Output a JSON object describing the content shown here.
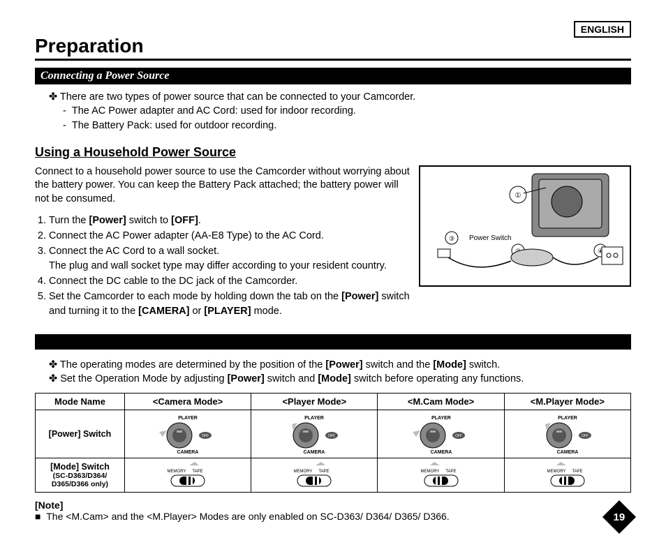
{
  "lang": "ENGLISH",
  "title": "Preparation",
  "section1": "Connecting a Power Source",
  "intro": "There are two types of power source that can be connected to your Camcorder.",
  "intro_sub1": "The AC Power adapter and AC Cord: used for indoor recording.",
  "intro_sub2": "The Battery Pack: used for outdoor recording.",
  "h2": "Using a Household Power Source",
  "para": "Connect to a household power source to use the Camcorder without worrying about the battery power. You can keep the Battery Pack attached; the battery power will not be consumed.",
  "step1a": "Turn the ",
  "step1b": "[Power]",
  "step1c": " switch to ",
  "step1d": "[OFF]",
  "step1e": ".",
  "step2": "Connect the AC Power adapter (AA-E8 Type) to the AC Cord.",
  "step3a": "Connect the AC Cord to a wall socket.",
  "step3b": "The plug and wall socket type may differ according to your resident country.",
  "step4": "Connect the DC cable to the DC jack of the Camcorder.",
  "step5a": "Set the Camcorder to each mode by holding down the tab on the ",
  "step5b": "[Power]",
  "step5c": " switch and turning it to the ",
  "step5d": "[CAMERA]",
  "step5e": " or ",
  "step5f": "[PLAYER]",
  "step5g": " mode.",
  "diagram_label": "Power Switch",
  "op1a": "The operating modes are determined by the position of the ",
  "op1b": "[Power]",
  "op1c": " switch and the ",
  "op1d": "[Mode]",
  "op1e": " switch.",
  "op2a": "Set the Operation Mode by adjusting ",
  "op2b": "[Power]",
  "op2c": " switch and ",
  "op2d": "[Mode]",
  "op2e": " switch before operating any functions.",
  "th0": "Mode Name",
  "th1": "<Camera Mode>",
  "th2": "<Player Mode>",
  "th3": "<M.Cam Mode>",
  "th4": "<M.Player Mode>",
  "r1": "[Power] Switch",
  "r2": "[Mode] Switch",
  "r2sub": "(SC-D363/D364/ D365/D366 only)",
  "dial_player": "PLAYER",
  "dial_camera": "CAMERA",
  "dial_off": "OFF",
  "sw_memory": "MEMORY",
  "sw_tape": "TAPE",
  "note_h": "[Note]",
  "note_t": "The <M.Cam> and the <M.Player> Modes are only enabled on SC-D363/ D364/ D365/ D366.",
  "pagenum": "19"
}
